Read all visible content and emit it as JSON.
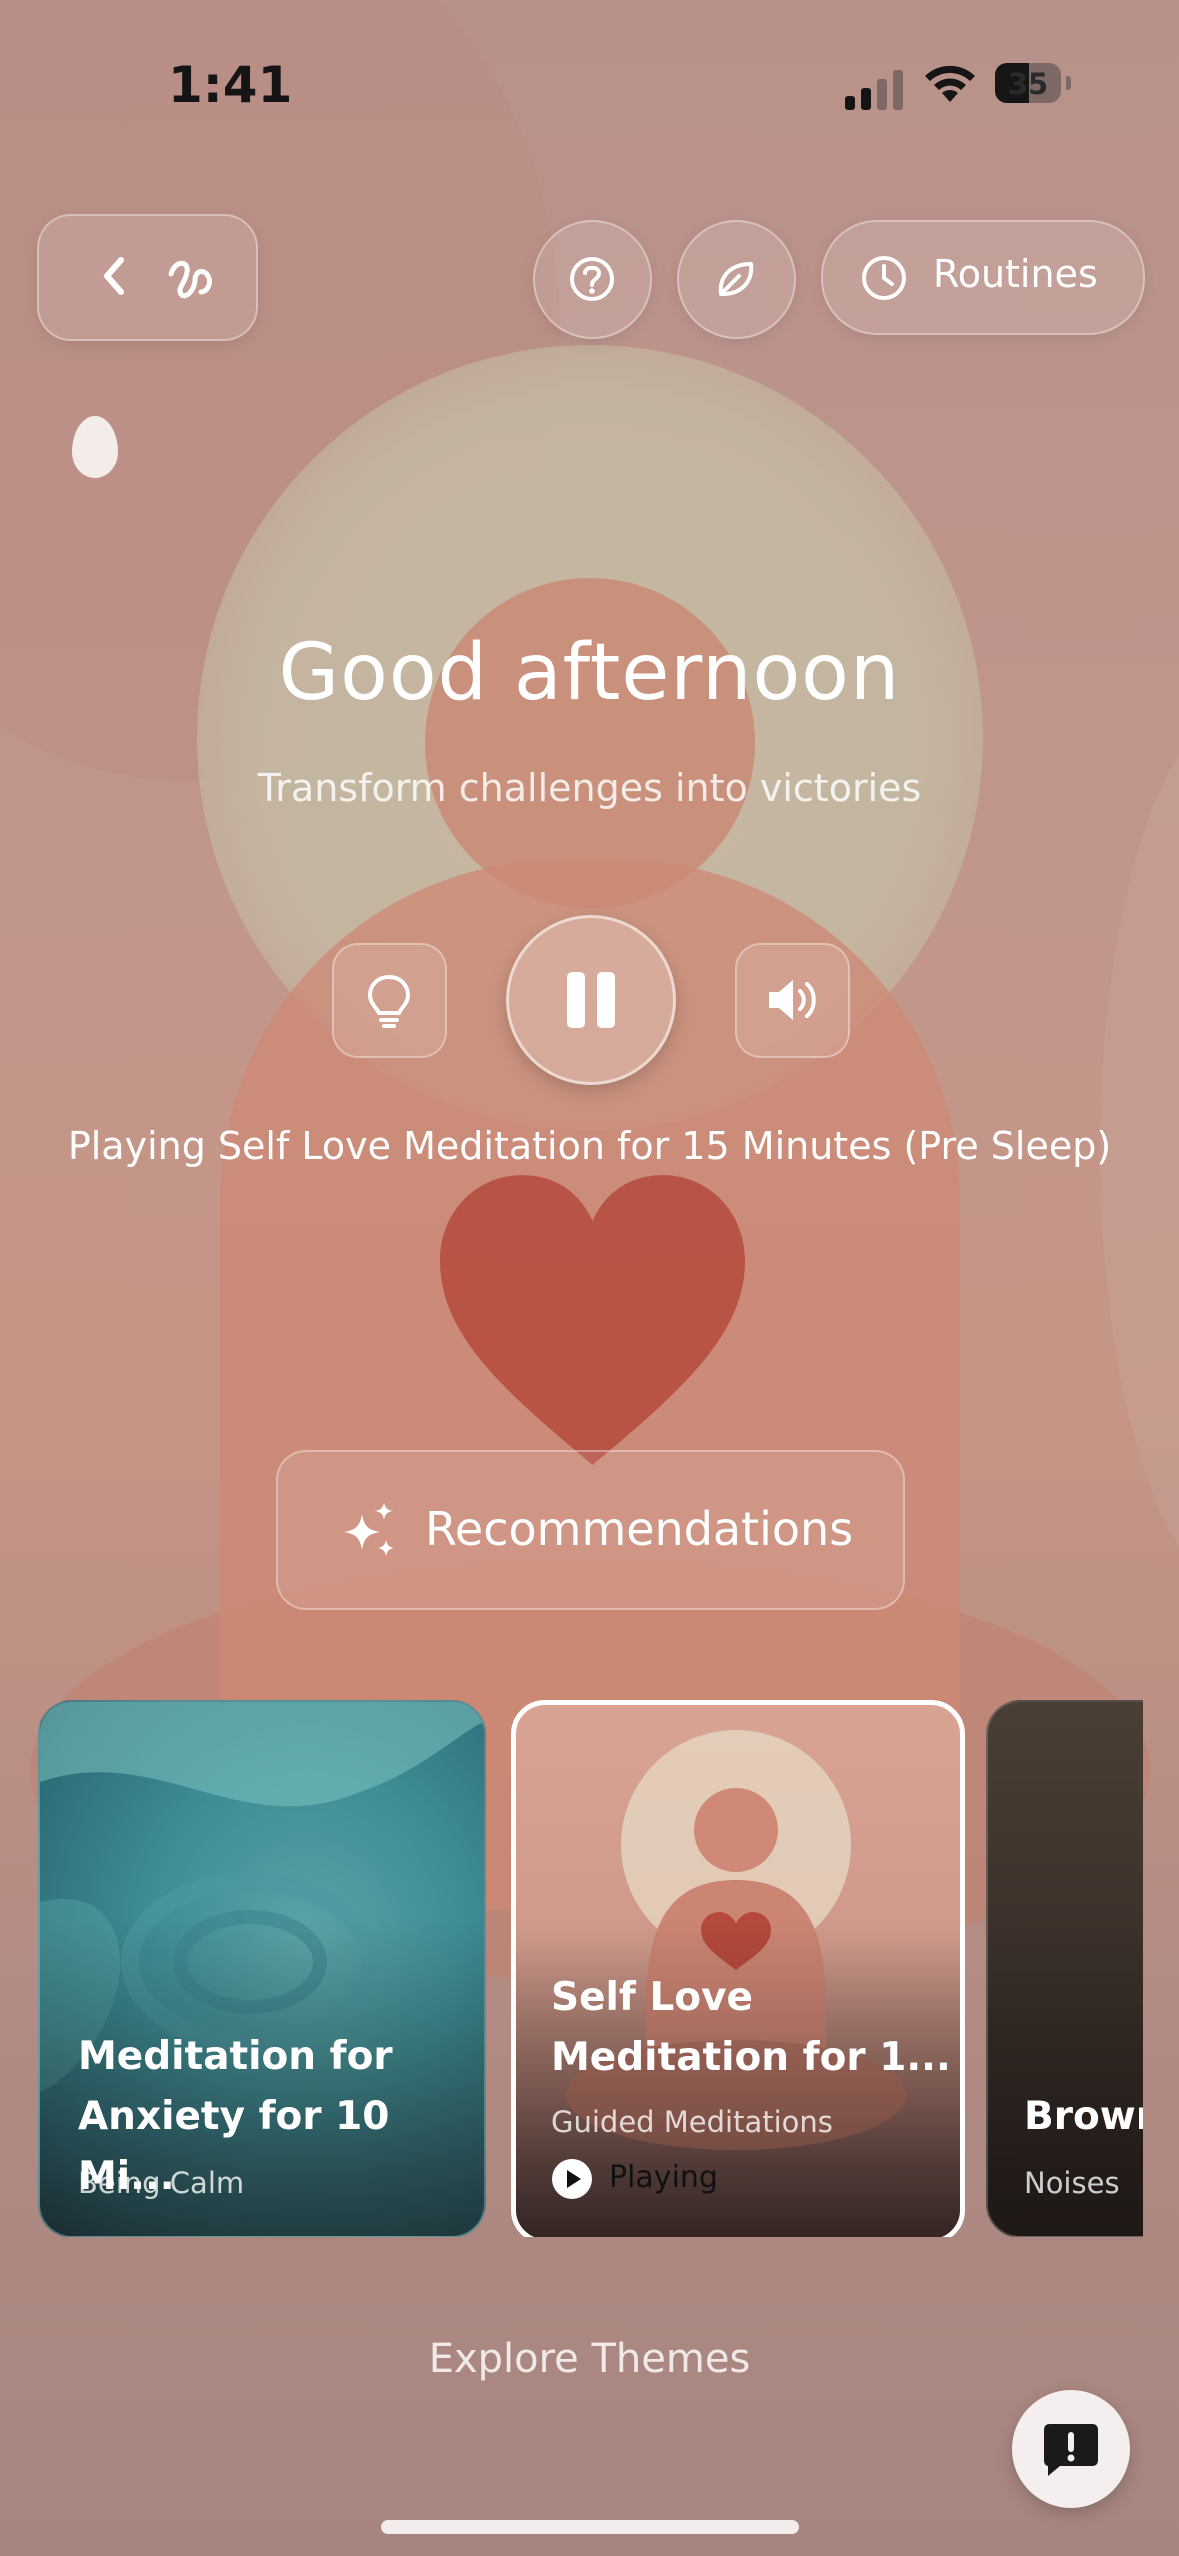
{
  "status_bar": {
    "time": "1:41",
    "battery": "35"
  },
  "top_bar": {
    "back_icon": "chevron-left-icon",
    "logo_icon": "squiggle-logo-icon",
    "help_icon": "question-circle-icon",
    "leaf_icon": "leaf-icon",
    "routines_icon": "clock-icon",
    "routines_label": "Routines"
  },
  "hero": {
    "greeting": "Good afternoon",
    "subtitle": "Transform challenges into victories",
    "now_playing": "Playing Self Love Meditation for 15 Minutes (Pre Sleep)",
    "is_playing": true
  },
  "controls": {
    "hint_icon": "lightbulb-icon",
    "play_icon": "pause-icon",
    "volume_icon": "speaker-icon"
  },
  "recommendations": {
    "icon": "sparkles-icon",
    "label": "Recommendations"
  },
  "cards": [
    {
      "title_line1": "Meditation for",
      "title_line2": "Anxiety for 10 Mi...",
      "category": "Being Calm"
    },
    {
      "title_line1": "Self Love",
      "title_line2": "Meditation for 1...",
      "category": "Guided Meditations",
      "status": "Playing"
    },
    {
      "title_line1": "Brown",
      "category": "Noises"
    }
  ],
  "footer": {
    "explore": "Explore Themes",
    "feedback_icon": "exclamation-chat-icon"
  },
  "colors": {
    "accent_heart": "#b54a3c",
    "background": "#b48f86"
  }
}
